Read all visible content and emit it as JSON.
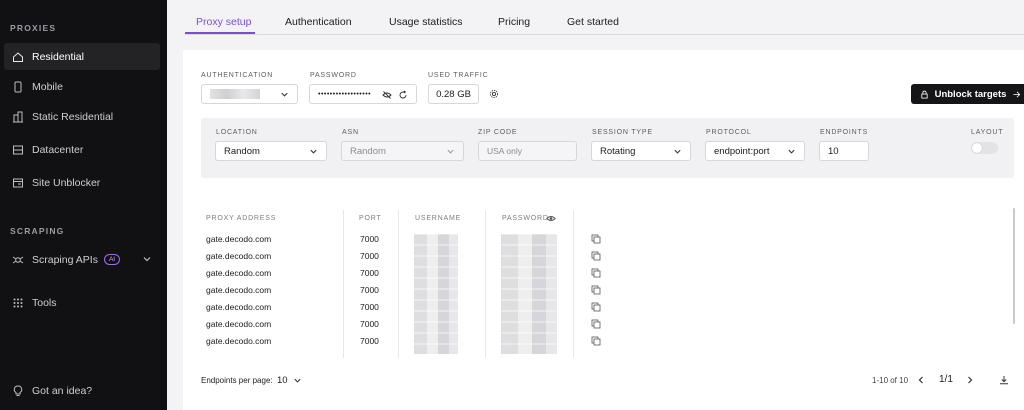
{
  "sidebar": {
    "proxies_title": "PROXIES",
    "items": [
      {
        "label": "Residential",
        "icon": "home-icon"
      },
      {
        "label": "Mobile",
        "icon": "phone-icon"
      },
      {
        "label": "Static Residential",
        "icon": "building-icon"
      },
      {
        "label": "Datacenter",
        "icon": "server-icon"
      },
      {
        "label": "Site Unblocker",
        "icon": "unblock-icon"
      }
    ],
    "scraping_title": "SCRAPING",
    "scraping_items": [
      {
        "label": "Scraping APIs",
        "badge": "AI",
        "icon": "spider-icon"
      },
      {
        "label": "Tools",
        "icon": "grid-icon"
      }
    ],
    "bottom": {
      "label": "Got an idea?",
      "icon": "lightbulb-icon"
    }
  },
  "tabs": [
    "Proxy setup",
    "Authentication",
    "Usage statistics",
    "Pricing",
    "Get started"
  ],
  "top": {
    "auth_label": "AUTHENTICATION",
    "password_label": "PASSWORD",
    "password_value": "••••••••••••••••••",
    "traffic_label": "USED TRAFFIC",
    "traffic_value": "0.28 GB",
    "unblock_label": "Unblock targets"
  },
  "filters": {
    "location_label": "LOCATION",
    "location_value": "Random",
    "asn_label": "ASN",
    "asn_value": "Random",
    "zip_label": "ZIP CODE",
    "zip_placeholder": "USA only",
    "session_label": "SESSION TYPE",
    "session_value": "Rotating",
    "protocol_label": "PROTOCOL",
    "protocol_value": "endpoint:port",
    "endpoints_label": "ENDPOINTS",
    "endpoints_value": "10",
    "layout_label": "LAYOUT"
  },
  "table": {
    "headers": [
      "PROXY ADDRESS",
      "PORT",
      "USERNAME",
      "PASSWORD"
    ],
    "rows": [
      {
        "address": "gate.decodo.com",
        "port": "7000"
      },
      {
        "address": "gate.decodo.com",
        "port": "7000"
      },
      {
        "address": "gate.decodo.com",
        "port": "7000"
      },
      {
        "address": "gate.decodo.com",
        "port": "7000"
      },
      {
        "address": "gate.decodo.com",
        "port": "7000"
      },
      {
        "address": "gate.decodo.com",
        "port": "7000"
      },
      {
        "address": "gate.decodo.com",
        "port": "7000"
      }
    ]
  },
  "footer": {
    "per_page_label": "Endpoints per page:",
    "per_page_value": "10",
    "range": "1-10 of 10",
    "page": "1/1"
  },
  "colors": {
    "accent": "#7b4dd6",
    "sidebar_bg": "#111113"
  }
}
